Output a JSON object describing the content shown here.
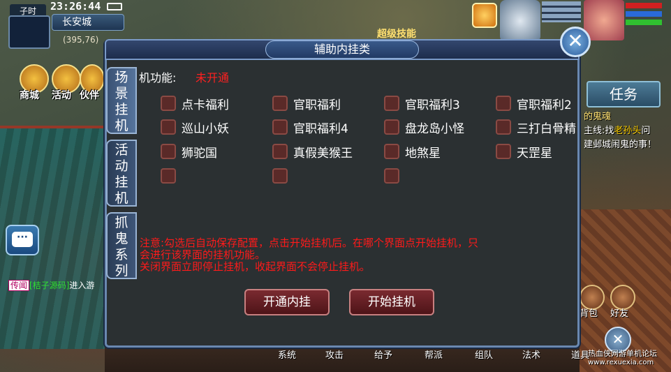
{
  "status": {
    "time_period": "子时",
    "clock": "23:26:44",
    "city": "长安城",
    "coords": "(395,76)"
  },
  "top_menu": [
    {
      "label": "商城",
      "icon": "gift-bag-icon"
    },
    {
      "label": "活动",
      "icon": "gold-coin-icon"
    },
    {
      "label": "伙伴",
      "icon": "partner-icon"
    }
  ],
  "super_skill": "超级技能",
  "task_button": "任务",
  "quest": {
    "title": "的鬼魂",
    "line1_prefix": "主线:找",
    "npc": "老孙头",
    "line1_suffix": "问",
    "line2": "建邺城闹鬼的事！"
  },
  "chat_icon": "chat-bubble-icon",
  "rumor": {
    "tag": "传闻",
    "name": "[桔子源码]",
    "text": "进入游"
  },
  "bottom_bar": [
    "系统",
    "攻击",
    "给予",
    "帮派",
    "组队",
    "法术",
    "道具"
  ],
  "bottom_right": [
    "背包",
    "好友"
  ],
  "watermark": {
    "text": "热血侠网游单机论坛",
    "url": "www.rexuexia.com"
  },
  "dialog": {
    "title": "辅助内挂类",
    "close_label": "✕",
    "tabs": [
      {
        "label": "场景挂机",
        "chars": [
          "场",
          "景",
          "挂",
          "机"
        ]
      },
      {
        "label": "活动挂机",
        "chars": [
          "活",
          "动",
          "挂",
          "机"
        ]
      },
      {
        "label": "抓鬼系列",
        "chars": [
          "抓",
          "鬼",
          "系",
          "列"
        ]
      }
    ],
    "function_label": "机功能:",
    "function_status": "未开通",
    "options": [
      "点卡福利",
      "官职福利",
      "官职福利3",
      "官职福利2",
      "巡山小妖",
      "官职福利4",
      "盘龙岛小怪",
      "三打白骨精",
      "狮驼国",
      "真假美猴王",
      "地煞星",
      "天罡星",
      "",
      "",
      ""
    ],
    "notice_line1": "注意:勾选后自动保存配置，点击开始挂机后。在哪个界面点开始挂机，只",
    "notice_line2": "会进行该界面的挂机功能。",
    "notice_line3": "关闭界面立即停止挂机，收起界面不会停止挂机。",
    "buttons": {
      "activate": "开通内挂",
      "start": "开始挂机"
    }
  }
}
